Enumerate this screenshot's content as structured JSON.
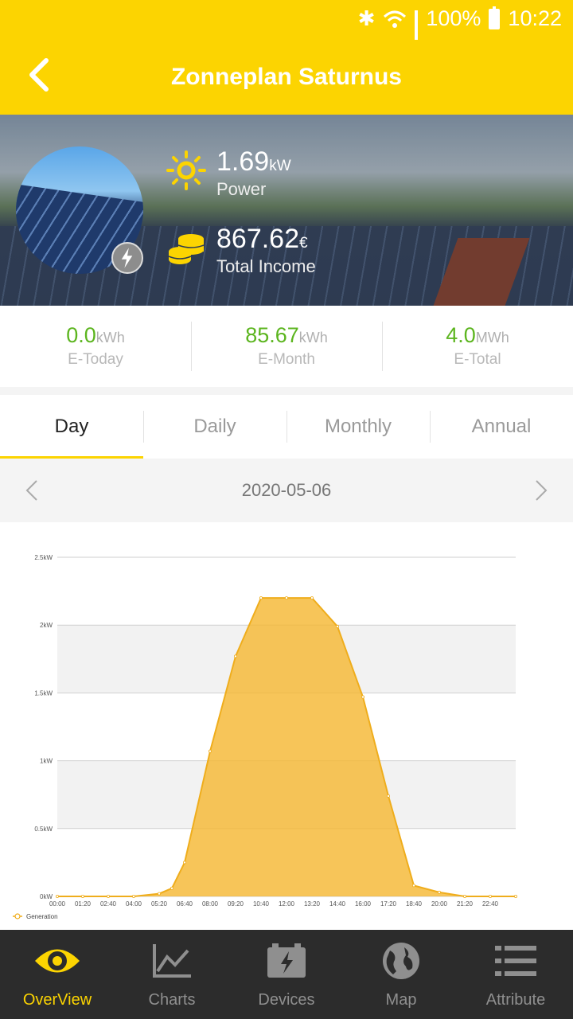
{
  "status_bar": {
    "battery": "100%",
    "time": "10:22"
  },
  "app_bar": {
    "title": "Zonneplan Saturnus"
  },
  "hero": {
    "power_value": "1.69",
    "power_unit": "kW",
    "power_label": "Power",
    "income_value": "867.62",
    "income_unit": "€",
    "income_label": "Total Income"
  },
  "stats": [
    {
      "value": "0.0",
      "unit": "kWh",
      "label": "E-Today"
    },
    {
      "value": "85.67",
      "unit": "kWh",
      "label": "E-Month"
    },
    {
      "value": "4.0",
      "unit": "MWh",
      "label": "E-Total"
    }
  ],
  "tabs": [
    {
      "label": "Day",
      "active": true
    },
    {
      "label": "Daily",
      "active": false
    },
    {
      "label": "Monthly",
      "active": false
    },
    {
      "label": "Annual",
      "active": false
    }
  ],
  "date_bar": {
    "date": "2020-05-06"
  },
  "chart_data": {
    "type": "area",
    "ylim": [
      0,
      2.5
    ],
    "y_ticks": [
      "0kW",
      "0.5kW",
      "1kW",
      "1.5kW",
      "2kW",
      "2.5kW"
    ],
    "x_ticks": [
      "00:00",
      "01:20",
      "02:40",
      "04:00",
      "05:20",
      "06:40",
      "08:00",
      "09:20",
      "10:40",
      "12:00",
      "13:20",
      "14:40",
      "16:00",
      "17:20",
      "18:40",
      "20:00",
      "21:20",
      "22:40"
    ],
    "series": [
      {
        "name": "Generation",
        "color": "#f5b730",
        "x": [
          "00:00",
          "01:20",
          "02:40",
          "04:00",
          "05:20",
          "06:00",
          "06:40",
          "08:00",
          "09:20",
          "10:40",
          "12:00",
          "13:20",
          "14:40",
          "16:00",
          "17:20",
          "18:40",
          "20:00",
          "21:20",
          "22:40",
          "24:00"
        ],
        "values": [
          0,
          0,
          0,
          0,
          0.02,
          0.06,
          0.25,
          1.07,
          1.77,
          2.2,
          2.2,
          2.2,
          1.99,
          1.47,
          0.74,
          0.08,
          0.03,
          0,
          0,
          0
        ]
      }
    ],
    "legend_position": "bottom-left",
    "grid": true
  },
  "bottom_nav": [
    {
      "label": "OverView",
      "icon": "eye-icon",
      "active": true
    },
    {
      "label": "Charts",
      "icon": "line-chart-icon",
      "active": false
    },
    {
      "label": "Devices",
      "icon": "battery-bolt-icon",
      "active": false
    },
    {
      "label": "Map",
      "icon": "globe-icon",
      "active": false
    },
    {
      "label": "Attribute",
      "icon": "list-icon",
      "active": false
    }
  ],
  "colors": {
    "brand_yellow": "#fcd401",
    "stat_green": "#5cb51f",
    "nav_bg": "#2c2c2c"
  }
}
